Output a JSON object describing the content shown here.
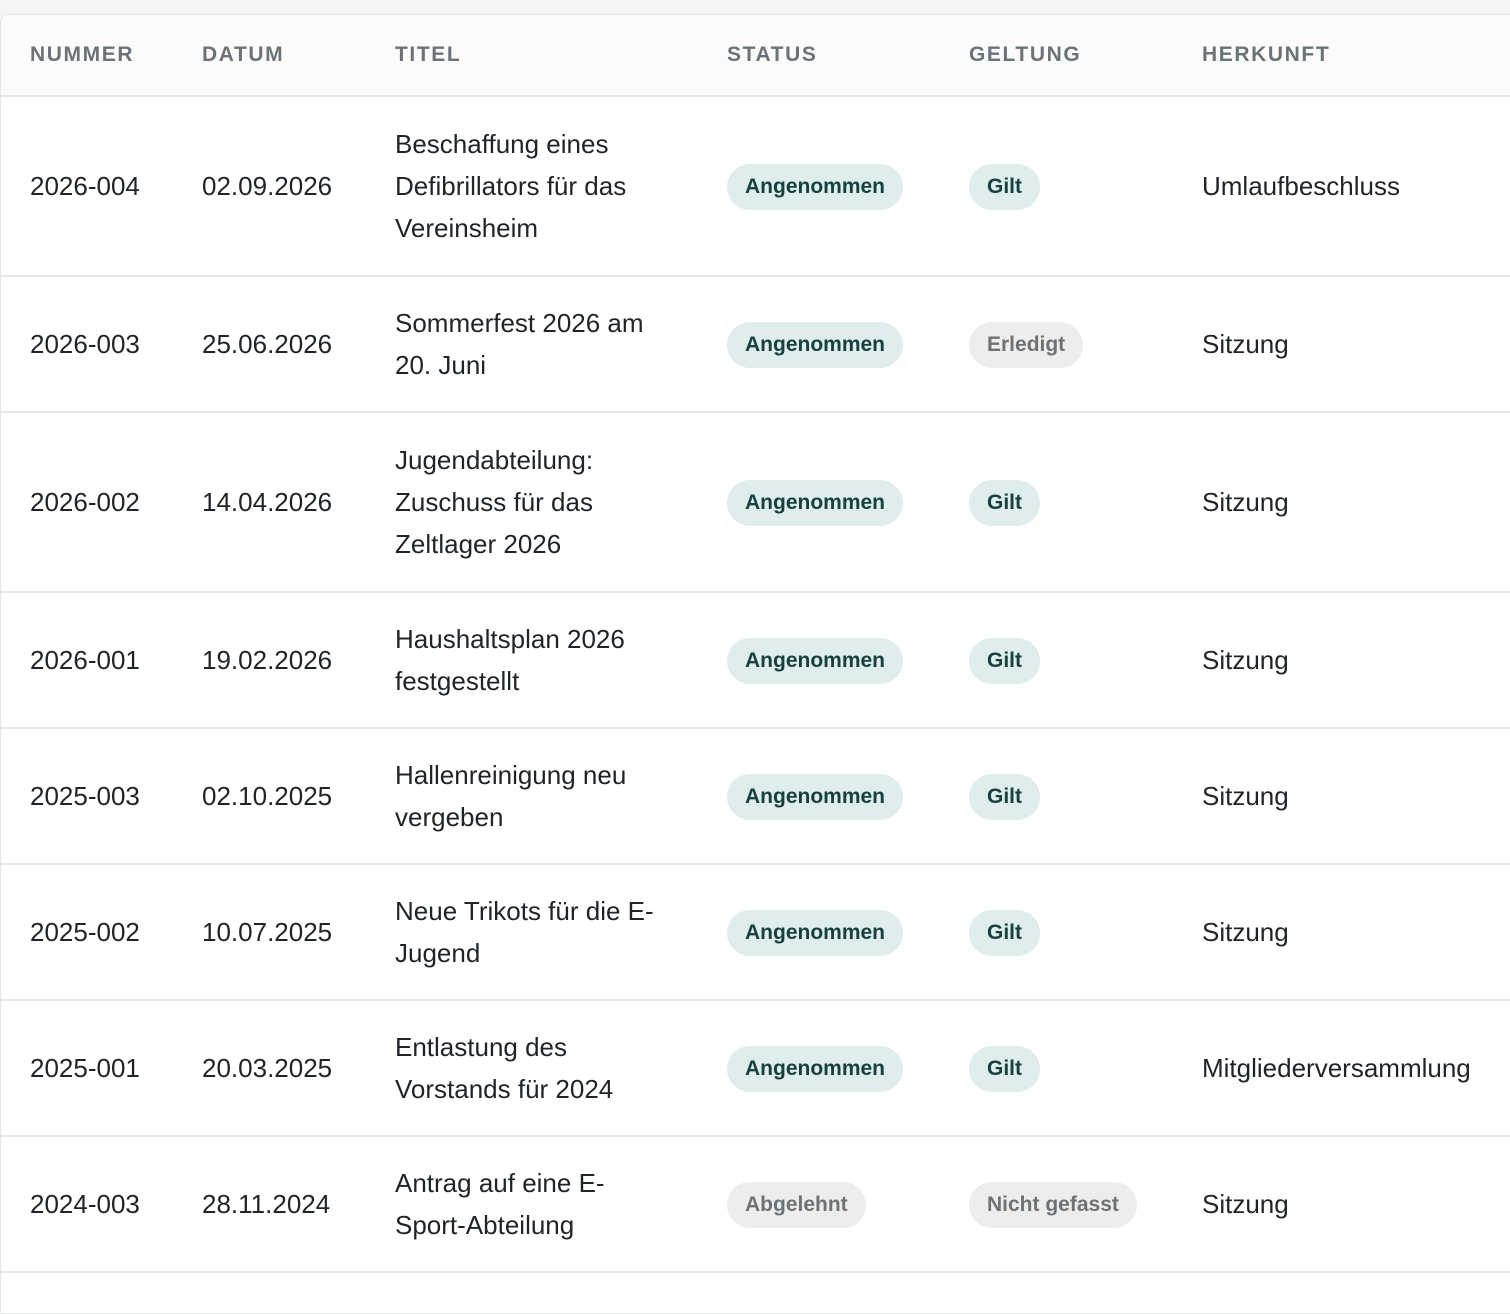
{
  "table": {
    "headers": [
      "NUMMER",
      "DATUM",
      "TITEL",
      "STATUS",
      "GELTUNG",
      "HERKUNFT"
    ],
    "rows": [
      {
        "nummer": "2026-004",
        "datum": "02.09.2026",
        "titel": "Beschaffung eines Defibrillators für das Vereinsheim",
        "status": "Angenommen",
        "status_tone": "teal",
        "geltung": "Gilt",
        "geltung_tone": "teal",
        "herkunft": "Umlaufbeschluss"
      },
      {
        "nummer": "2026-003",
        "datum": "25.06.2026",
        "titel": "Sommerfest 2026 am 20. Juni",
        "status": "Angenommen",
        "status_tone": "teal",
        "geltung": "Erledigt",
        "geltung_tone": "grey",
        "herkunft": "Sitzung"
      },
      {
        "nummer": "2026-002",
        "datum": "14.04.2026",
        "titel": "Jugendabteilung: Zuschuss für das Zeltlager 2026",
        "status": "Angenommen",
        "status_tone": "teal",
        "geltung": "Gilt",
        "geltung_tone": "teal",
        "herkunft": "Sitzung"
      },
      {
        "nummer": "2026-001",
        "datum": "19.02.2026",
        "titel": "Haushaltsplan 2026 festgestellt",
        "status": "Angenommen",
        "status_tone": "teal",
        "geltung": "Gilt",
        "geltung_tone": "teal",
        "herkunft": "Sitzung"
      },
      {
        "nummer": "2025-003",
        "datum": "02.10.2025",
        "titel": "Hallenreinigung neu vergeben",
        "status": "Angenommen",
        "status_tone": "teal",
        "geltung": "Gilt",
        "geltung_tone": "teal",
        "herkunft": "Sitzung"
      },
      {
        "nummer": "2025-002",
        "datum": "10.07.2025",
        "titel": "Neue Trikots für die E-Jugend",
        "status": "Angenommen",
        "status_tone": "teal",
        "geltung": "Gilt",
        "geltung_tone": "teal",
        "herkunft": "Sitzung"
      },
      {
        "nummer": "2025-001",
        "datum": "20.03.2025",
        "titel": "Entlastung des Vorstands für 2024",
        "status": "Angenommen",
        "status_tone": "teal",
        "geltung": "Gilt",
        "geltung_tone": "teal",
        "herkunft": "Mitgliederversammlung"
      },
      {
        "nummer": "2024-003",
        "datum": "28.11.2024",
        "titel": "Antrag auf eine E-Sport-Abteilung",
        "status": "Abgelehnt",
        "status_tone": "grey",
        "geltung": "Nicht gefasst",
        "geltung_tone": "grey",
        "herkunft": "Sitzung"
      }
    ]
  },
  "colors": {
    "pill_teal_bg": "#dfeded",
    "pill_teal_text": "#17413f",
    "pill_grey_bg": "#ededed",
    "pill_grey_text": "#6e7275"
  }
}
